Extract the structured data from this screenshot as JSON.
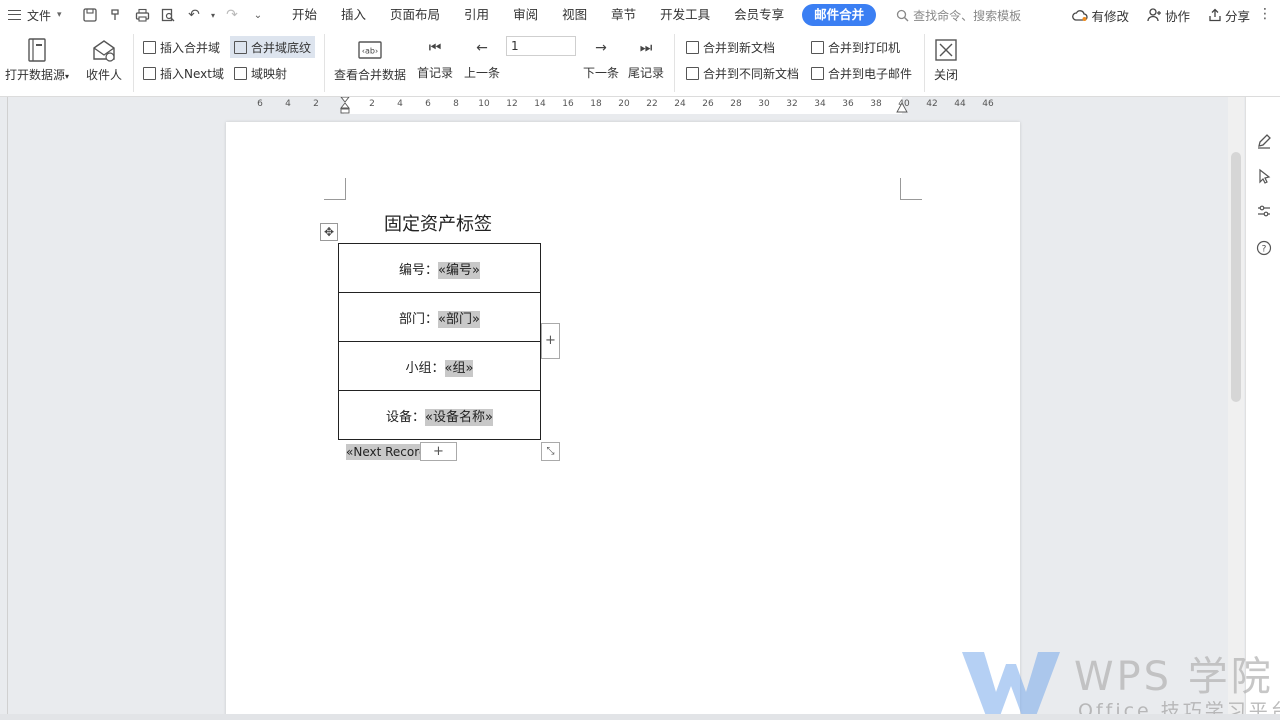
{
  "menubar": {
    "file_label": "文件",
    "tabs": [
      "开始",
      "插入",
      "页面布局",
      "引用",
      "审阅",
      "视图",
      "章节",
      "开发工具",
      "会员专享",
      "邮件合并"
    ],
    "search_placeholder": "查找命令、搜索模板",
    "actions": {
      "revise": "有修改",
      "collab": "协作",
      "share": "分享"
    }
  },
  "ribbon": {
    "open_source": "打开数据源",
    "recipients": "收件人",
    "insert_field": "插入合并域",
    "field_shading": "合并域底纹",
    "insert_next": "插入Next域",
    "field_map": "域映射",
    "view_data": "查看合并数据",
    "first": "首记录",
    "prev": "上一条",
    "record_number": "1",
    "next": "下一条",
    "last": "尾记录",
    "to_new_doc": "合并到新文档",
    "to_diff_docs": "合并到不同新文档",
    "to_printer": "合并到打印机",
    "to_email": "合并到电子邮件",
    "close": "关闭"
  },
  "ruler": {
    "ticks": [
      "6",
      "4",
      "2",
      "2",
      "4",
      "6",
      "8",
      "10",
      "12",
      "14",
      "16",
      "18",
      "20",
      "22",
      "24",
      "26",
      "28",
      "30",
      "32",
      "34",
      "36",
      "38",
      "40",
      "42",
      "44",
      "46"
    ]
  },
  "document": {
    "title": "固定资产标签",
    "rows": [
      {
        "label": "编号：",
        "field": "«编号»"
      },
      {
        "label": "部门：",
        "field": "«部门»"
      },
      {
        "label": "小组：",
        "field": "«组»"
      },
      {
        "label": "设备：",
        "field": "«设备名称»"
      }
    ],
    "next_record": "«Next Record»"
  },
  "watermark": {
    "brand": "WPS 学院",
    "slogan": "Office 技巧学习平台"
  },
  "colors": {
    "accent": "#3b7ff3",
    "field_shading": "#c8c8c8"
  }
}
